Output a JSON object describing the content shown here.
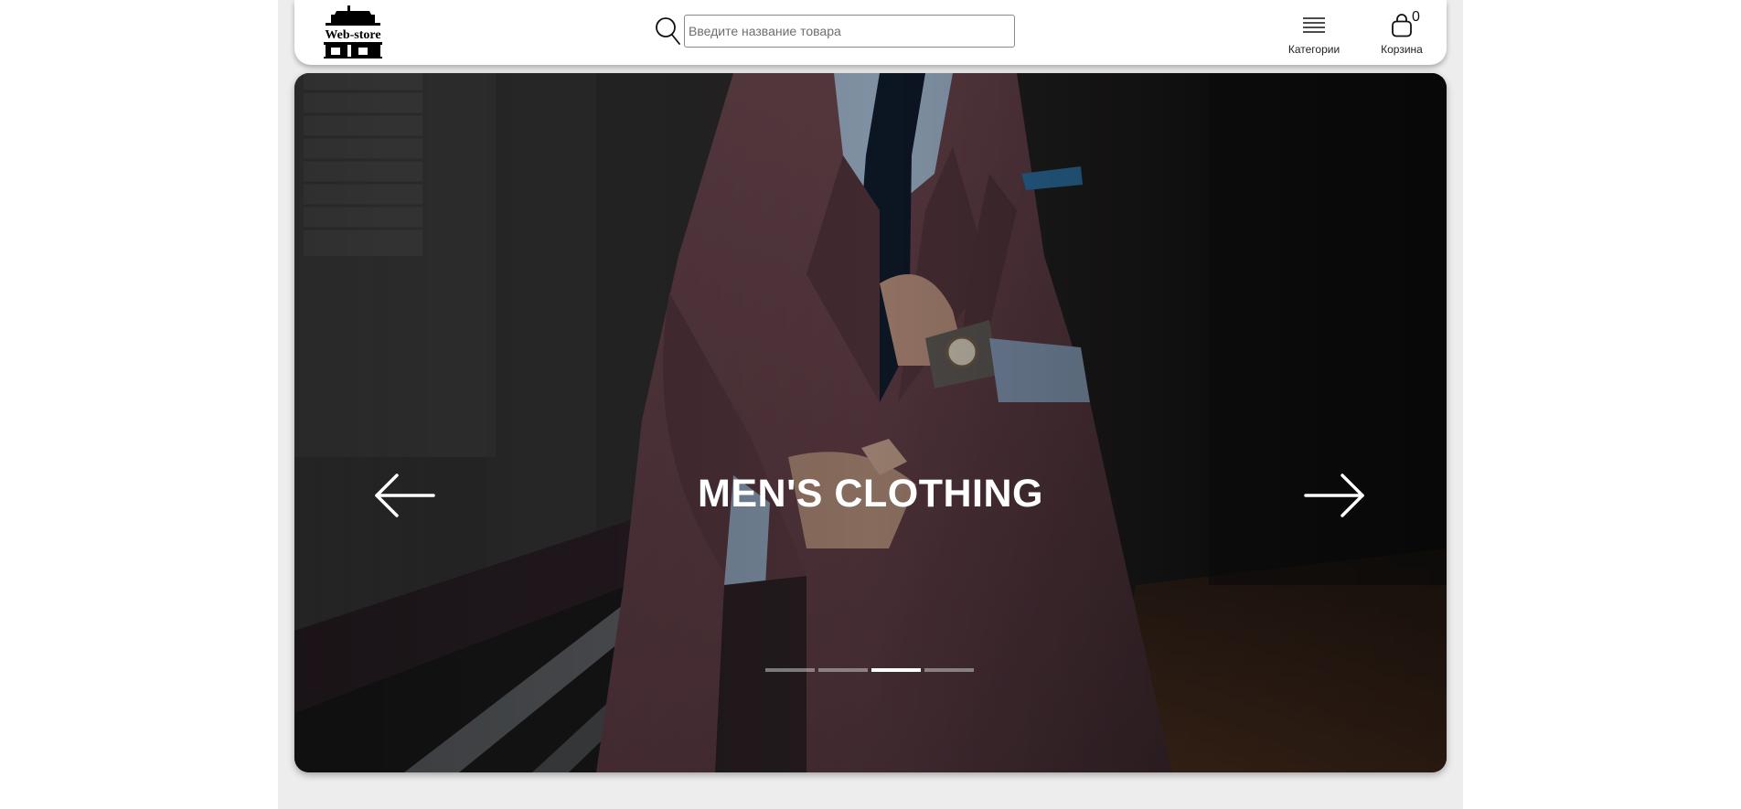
{
  "header": {
    "logo_text": "Web-store",
    "search": {
      "placeholder": "Введите название товара",
      "value": ""
    },
    "categories_label": "Категории",
    "cart_label": "Корзина",
    "cart_count": "0"
  },
  "slider": {
    "title": "MEN'S CLOTHING",
    "slides_total": 4,
    "active_slide": 3
  },
  "icons": [
    "search-icon",
    "menu-icon",
    "shopping-bag-icon",
    "arrow-left-icon",
    "arrow-right-icon"
  ],
  "colors": {
    "column_bg": "#ededed",
    "header_bg": "#ffffff",
    "title": "#ffffff"
  }
}
